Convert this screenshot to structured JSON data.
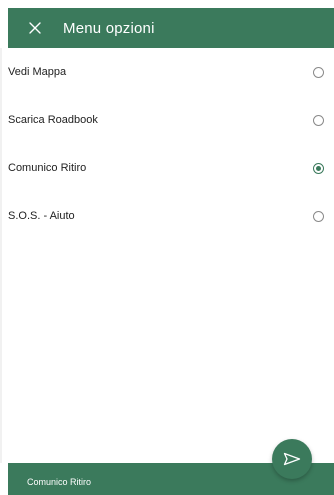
{
  "header": {
    "close_icon": "close-icon",
    "title": "Menu opzioni"
  },
  "options": [
    {
      "label": "Vedi Mappa",
      "selected": false
    },
    {
      "label": "Scarica Roadbook",
      "selected": false
    },
    {
      "label": "Comunico Ritiro",
      "selected": true
    },
    {
      "label": "S.O.S. - Aiuto",
      "selected": false
    }
  ],
  "footer": {
    "selected_label": "Comunico Ritiro"
  },
  "fab": {
    "icon": "send-icon"
  },
  "colors": {
    "primary": "#3b7a5c",
    "text": "#222222",
    "radio_border": "#8a8a8a"
  }
}
